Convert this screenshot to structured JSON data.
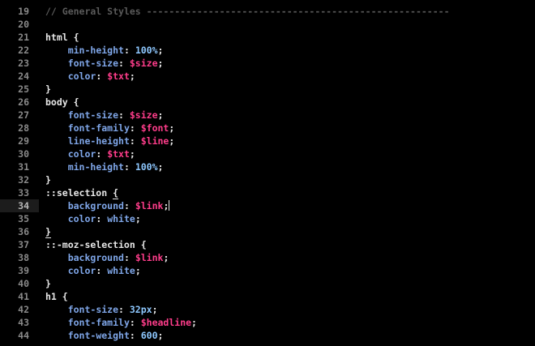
{
  "editor": {
    "active_line": 34,
    "lines": [
      {
        "n": "19",
        "tokens": [
          {
            "t": "comment",
            "v": "// General Styles ------------------------------------------------------"
          }
        ]
      },
      {
        "n": "20",
        "tokens": []
      },
      {
        "n": "21",
        "tokens": [
          {
            "t": "plain",
            "v": "html {"
          }
        ]
      },
      {
        "n": "22",
        "tokens": [
          {
            "t": "plain",
            "v": "    "
          },
          {
            "t": "prop",
            "v": "min-height"
          },
          {
            "t": "plain",
            "v": ": "
          },
          {
            "t": "num",
            "v": "100%"
          },
          {
            "t": "plain",
            "v": ";"
          }
        ]
      },
      {
        "n": "23",
        "tokens": [
          {
            "t": "plain",
            "v": "    "
          },
          {
            "t": "prop",
            "v": "font-size"
          },
          {
            "t": "plain",
            "v": ": "
          },
          {
            "t": "var",
            "v": "$size"
          },
          {
            "t": "plain",
            "v": ";"
          }
        ]
      },
      {
        "n": "24",
        "tokens": [
          {
            "t": "plain",
            "v": "    "
          },
          {
            "t": "prop",
            "v": "color"
          },
          {
            "t": "plain",
            "v": ": "
          },
          {
            "t": "var",
            "v": "$txt"
          },
          {
            "t": "plain",
            "v": ";"
          }
        ]
      },
      {
        "n": "25",
        "tokens": [
          {
            "t": "plain",
            "v": "}"
          }
        ]
      },
      {
        "n": "26",
        "tokens": [
          {
            "t": "plain",
            "v": "body {"
          }
        ]
      },
      {
        "n": "27",
        "tokens": [
          {
            "t": "plain",
            "v": "    "
          },
          {
            "t": "prop",
            "v": "font-size"
          },
          {
            "t": "plain",
            "v": ": "
          },
          {
            "t": "var",
            "v": "$size"
          },
          {
            "t": "plain",
            "v": ";"
          }
        ]
      },
      {
        "n": "28",
        "tokens": [
          {
            "t": "plain",
            "v": "    "
          },
          {
            "t": "prop",
            "v": "font-family"
          },
          {
            "t": "plain",
            "v": ": "
          },
          {
            "t": "var",
            "v": "$font"
          },
          {
            "t": "plain",
            "v": ";"
          }
        ]
      },
      {
        "n": "29",
        "tokens": [
          {
            "t": "plain",
            "v": "    "
          },
          {
            "t": "prop",
            "v": "line-height"
          },
          {
            "t": "plain",
            "v": ": "
          },
          {
            "t": "var",
            "v": "$line"
          },
          {
            "t": "plain",
            "v": ";"
          }
        ]
      },
      {
        "n": "30",
        "tokens": [
          {
            "t": "plain",
            "v": "    "
          },
          {
            "t": "prop",
            "v": "color"
          },
          {
            "t": "plain",
            "v": ": "
          },
          {
            "t": "var",
            "v": "$txt"
          },
          {
            "t": "plain",
            "v": ";"
          }
        ]
      },
      {
        "n": "31",
        "tokens": [
          {
            "t": "plain",
            "v": "    "
          },
          {
            "t": "prop",
            "v": "min-height"
          },
          {
            "t": "plain",
            "v": ": "
          },
          {
            "t": "num",
            "v": "100%"
          },
          {
            "t": "plain",
            "v": ";"
          }
        ]
      },
      {
        "n": "32",
        "tokens": [
          {
            "t": "plain",
            "v": "}"
          }
        ]
      },
      {
        "n": "33",
        "tokens": [
          {
            "t": "plain",
            "v": "::selection "
          },
          {
            "t": "brace",
            "v": "{"
          }
        ]
      },
      {
        "n": "34",
        "tokens": [
          {
            "t": "plain",
            "v": "    "
          },
          {
            "t": "prop",
            "v": "background"
          },
          {
            "t": "plain",
            "v": ": "
          },
          {
            "t": "var",
            "v": "$link"
          },
          {
            "t": "plain",
            "v": ";"
          },
          {
            "t": "caret",
            "v": ""
          }
        ]
      },
      {
        "n": "35",
        "tokens": [
          {
            "t": "plain",
            "v": "    "
          },
          {
            "t": "prop",
            "v": "color"
          },
          {
            "t": "plain",
            "v": ": "
          },
          {
            "t": "prop",
            "v": "white"
          },
          {
            "t": "plain",
            "v": ";"
          }
        ]
      },
      {
        "n": "36",
        "tokens": [
          {
            "t": "brace",
            "v": "}"
          }
        ]
      },
      {
        "n": "37",
        "tokens": [
          {
            "t": "plain",
            "v": "::-moz-selection {"
          }
        ]
      },
      {
        "n": "38",
        "tokens": [
          {
            "t": "plain",
            "v": "    "
          },
          {
            "t": "prop",
            "v": "background"
          },
          {
            "t": "plain",
            "v": ": "
          },
          {
            "t": "var",
            "v": "$link"
          },
          {
            "t": "plain",
            "v": ";"
          }
        ]
      },
      {
        "n": "39",
        "tokens": [
          {
            "t": "plain",
            "v": "    "
          },
          {
            "t": "prop",
            "v": "color"
          },
          {
            "t": "plain",
            "v": ": "
          },
          {
            "t": "prop",
            "v": "white"
          },
          {
            "t": "plain",
            "v": ";"
          }
        ]
      },
      {
        "n": "40",
        "tokens": [
          {
            "t": "plain",
            "v": "}"
          }
        ]
      },
      {
        "n": "41",
        "tokens": [
          {
            "t": "plain",
            "v": "h1 {"
          }
        ]
      },
      {
        "n": "42",
        "tokens": [
          {
            "t": "plain",
            "v": "    "
          },
          {
            "t": "prop",
            "v": "font-size"
          },
          {
            "t": "plain",
            "v": ": "
          },
          {
            "t": "num",
            "v": "32px"
          },
          {
            "t": "plain",
            "v": ";"
          }
        ]
      },
      {
        "n": "43",
        "tokens": [
          {
            "t": "plain",
            "v": "    "
          },
          {
            "t": "prop",
            "v": "font-family"
          },
          {
            "t": "plain",
            "v": ": "
          },
          {
            "t": "var",
            "v": "$headline"
          },
          {
            "t": "plain",
            "v": ";"
          }
        ]
      },
      {
        "n": "44",
        "tokens": [
          {
            "t": "plain",
            "v": "    "
          },
          {
            "t": "prop",
            "v": "font-weight"
          },
          {
            "t": "plain",
            "v": ": "
          },
          {
            "t": "num",
            "v": "600"
          },
          {
            "t": "plain",
            "v": ";"
          }
        ]
      }
    ]
  },
  "colors": {
    "background": "#000000",
    "gutter_text": "#8a8a8a",
    "plain": "#e6e6e6",
    "property": "#7fa6e8",
    "variable": "#ff3d8b",
    "number": "#8ec8ff",
    "comment": "#5a5a5a",
    "active_line": "#1c1c1c"
  }
}
